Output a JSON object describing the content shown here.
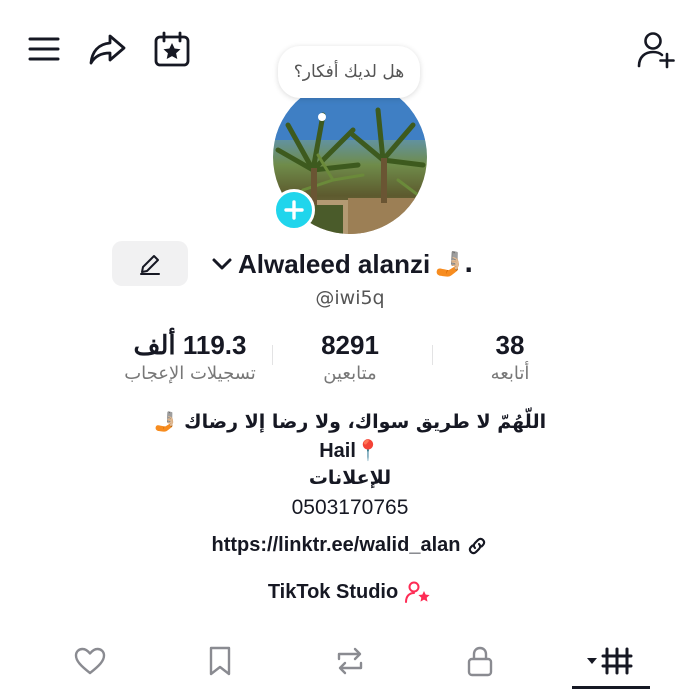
{
  "header": {
    "icons": [
      "menu-icon",
      "share-icon",
      "calendar-star-icon",
      "add-friend-icon"
    ]
  },
  "avatar": {
    "thought_prompt": "هل لديك أفكار؟",
    "add_icon": "plus-icon",
    "add_color": "#20d5ec"
  },
  "profile": {
    "display_name": "Alwaleed alanzi",
    "name_suffix": "🤳🏼.",
    "username": "@iwi5q",
    "edit_icon": "pencil-icon"
  },
  "stats": {
    "likes": {
      "value": "119.3 ألف",
      "label": "تسجيلات الإعجاب"
    },
    "followers": {
      "value": "8291",
      "label": "متابعين"
    },
    "following": {
      "value": "38",
      "label": "أتابعه"
    }
  },
  "bio": {
    "line1": "اللّهُمّ لا طريق سواك، ولا رضا إلا رضاك 🤳🏼",
    "line2": "Hail📍",
    "line3": "للإعلانات",
    "line4": "0503170765",
    "link": "https://linktr.ee/walid_alan",
    "studio": "TikTok Studio"
  },
  "tabs": [
    {
      "name": "liked",
      "icon": "heart-icon"
    },
    {
      "name": "saved",
      "icon": "bookmark-icon"
    },
    {
      "name": "reposts",
      "icon": "repost-icon"
    },
    {
      "name": "private",
      "icon": "lock-icon"
    },
    {
      "name": "videos",
      "icon": "grid-icon",
      "active": true
    }
  ],
  "colors": {
    "accent": "#20d5ec",
    "studio_icon": "#fe2c55",
    "text": "#161823"
  }
}
